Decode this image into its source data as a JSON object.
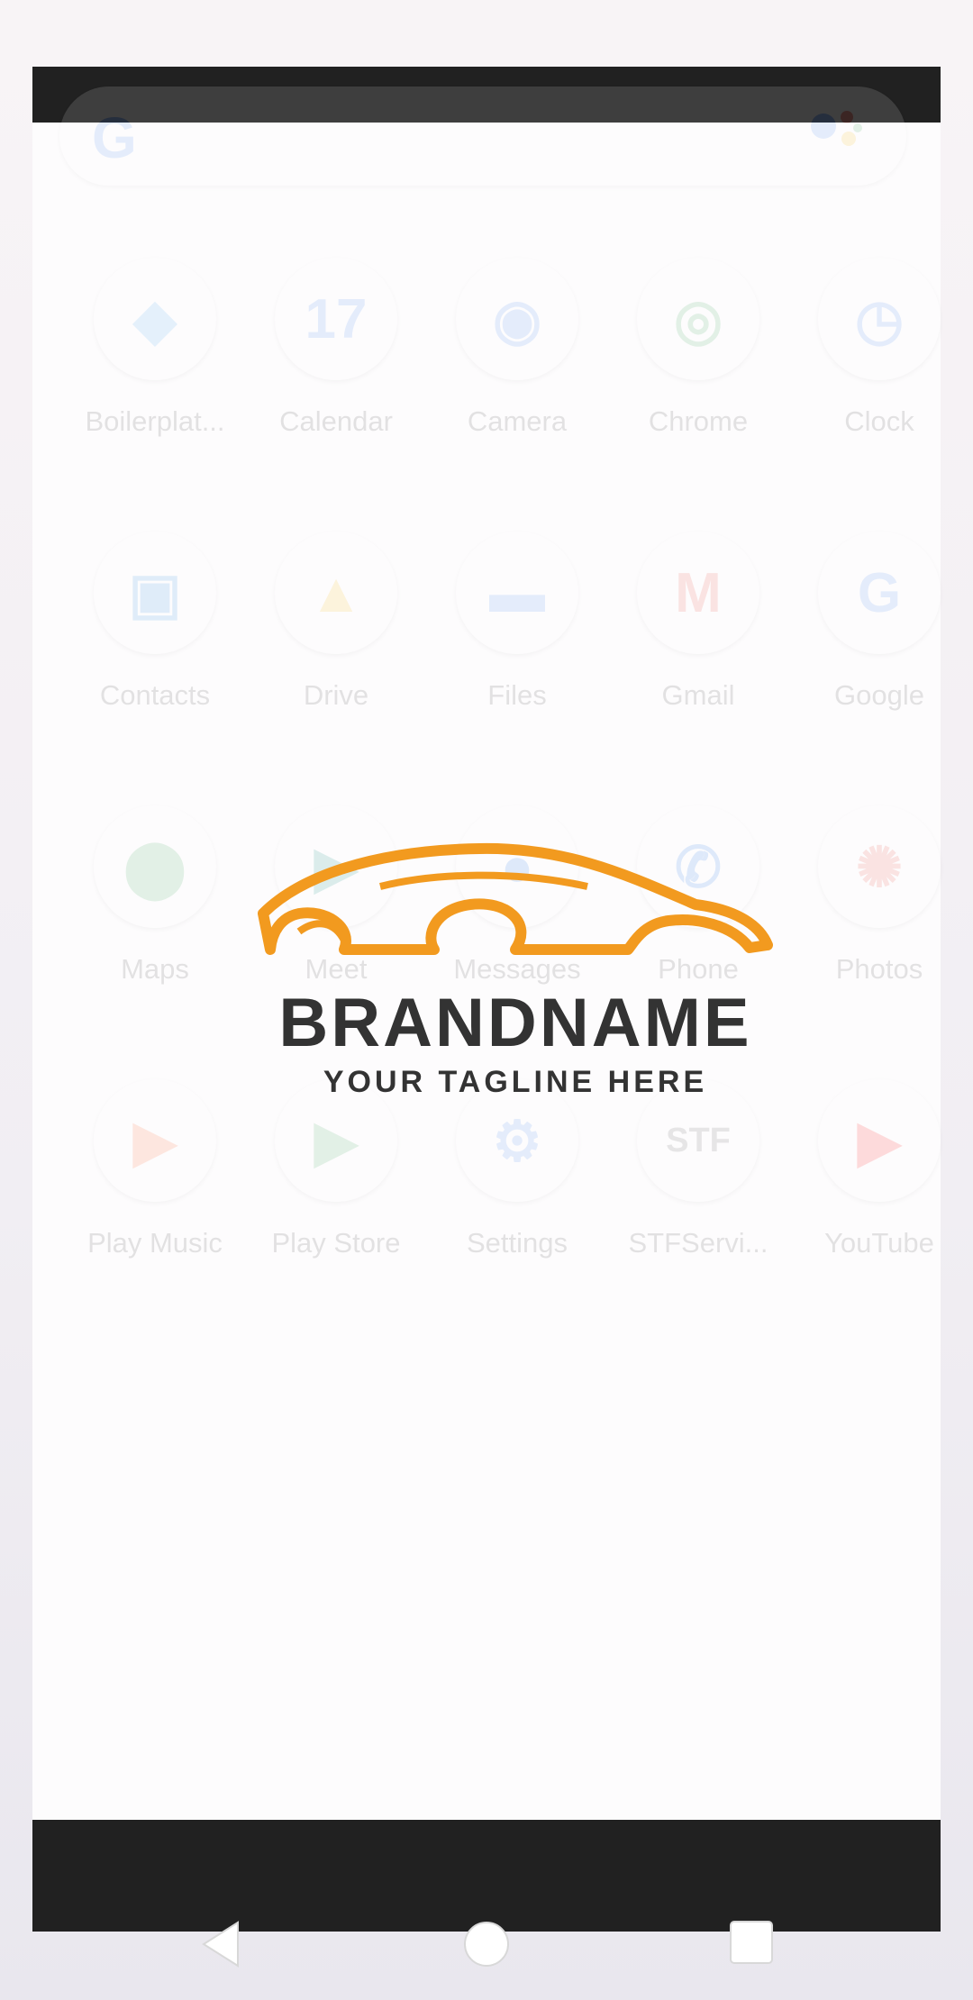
{
  "launcher": {
    "search_logo": "G",
    "apps": [
      {
        "label": "Boilerplat...",
        "icon": "flutter-icon",
        "glyph": "◆",
        "color": "#42a5f5"
      },
      {
        "label": "Calendar",
        "icon": "calendar-icon",
        "glyph": "17",
        "color": "#4285f4"
      },
      {
        "label": "Camera",
        "icon": "camera-icon",
        "glyph": "◉",
        "color": "#4285f4"
      },
      {
        "label": "Chrome",
        "icon": "chrome-icon",
        "glyph": "◎",
        "color": "#34a853"
      },
      {
        "label": "Clock",
        "icon": "clock-icon",
        "glyph": "◷",
        "color": "#4285f4"
      },
      {
        "label": "Contacts",
        "icon": "contacts-icon",
        "glyph": "▣",
        "color": "#1e88e5"
      },
      {
        "label": "Drive",
        "icon": "drive-icon",
        "glyph": "▲",
        "color": "#fbbc05"
      },
      {
        "label": "Files",
        "icon": "files-icon",
        "glyph": "▬",
        "color": "#4285f4"
      },
      {
        "label": "Gmail",
        "icon": "gmail-icon",
        "glyph": "M",
        "color": "#ea4335"
      },
      {
        "label": "Google",
        "icon": "google-icon",
        "glyph": "G",
        "color": "#4285f4"
      },
      {
        "label": "Maps",
        "icon": "maps-icon",
        "glyph": "⬤",
        "color": "#34a853"
      },
      {
        "label": "Meet",
        "icon": "meet-icon",
        "glyph": "▶",
        "color": "#00897b"
      },
      {
        "label": "Messages",
        "icon": "messages-icon",
        "glyph": "●",
        "color": "#1a73e8"
      },
      {
        "label": "Phone",
        "icon": "phone-icon",
        "glyph": "✆",
        "color": "#1a73e8"
      },
      {
        "label": "Photos",
        "icon": "photos-icon",
        "glyph": "✺",
        "color": "#ea4335"
      },
      {
        "label": "Play Music",
        "icon": "play-music-icon",
        "glyph": "▶",
        "color": "#ff5722"
      },
      {
        "label": "Play Store",
        "icon": "play-store-icon",
        "glyph": "▶",
        "color": "#34a853"
      },
      {
        "label": "Settings",
        "icon": "settings-icon",
        "glyph": "⚙",
        "color": "#4285f4"
      },
      {
        "label": "STFServi...",
        "icon": "stf-icon",
        "glyph": "STF",
        "color": "#555555"
      },
      {
        "label": "YouTube",
        "icon": "youtube-icon",
        "glyph": "▶",
        "color": "#ff0000"
      }
    ]
  },
  "splash": {
    "brand": "BRANDNAME",
    "tagline": "YOUR TAGLINE HERE",
    "accent_color": "#f29a1f",
    "text_color": "#333333"
  },
  "navbar": {
    "back": "back-icon",
    "home": "home-icon",
    "recents": "recents-icon"
  }
}
